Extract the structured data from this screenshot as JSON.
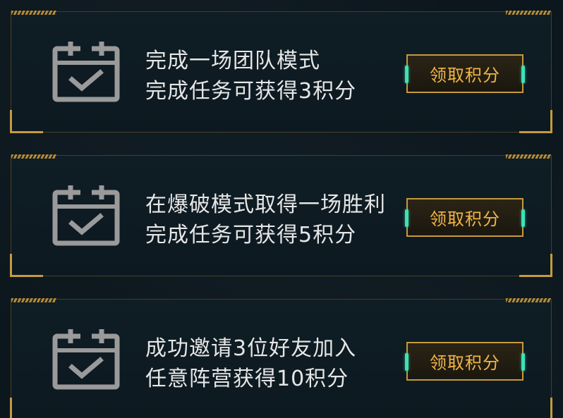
{
  "tasks": [
    {
      "title": "完成一场团队模式",
      "reward": "完成任务可获得3积分",
      "button_label": "领取积分",
      "icon": "calendar-check-icon"
    },
    {
      "title": "在爆破模式取得一场胜利",
      "reward": "完成任务可获得5积分",
      "button_label": "领取积分",
      "icon": "calendar-check-icon"
    },
    {
      "title": "成功邀请3位好友加入",
      "reward": "任意阵营获得10积分",
      "button_label": "领取积分",
      "icon": "calendar-check-icon"
    }
  ],
  "colors": {
    "accent_gold": "#c69a3e",
    "button_text": "#f0b545",
    "tab_green": "#3fe0b6",
    "icon_gray": "#9a9a9a",
    "text": "#e6e6e6"
  }
}
